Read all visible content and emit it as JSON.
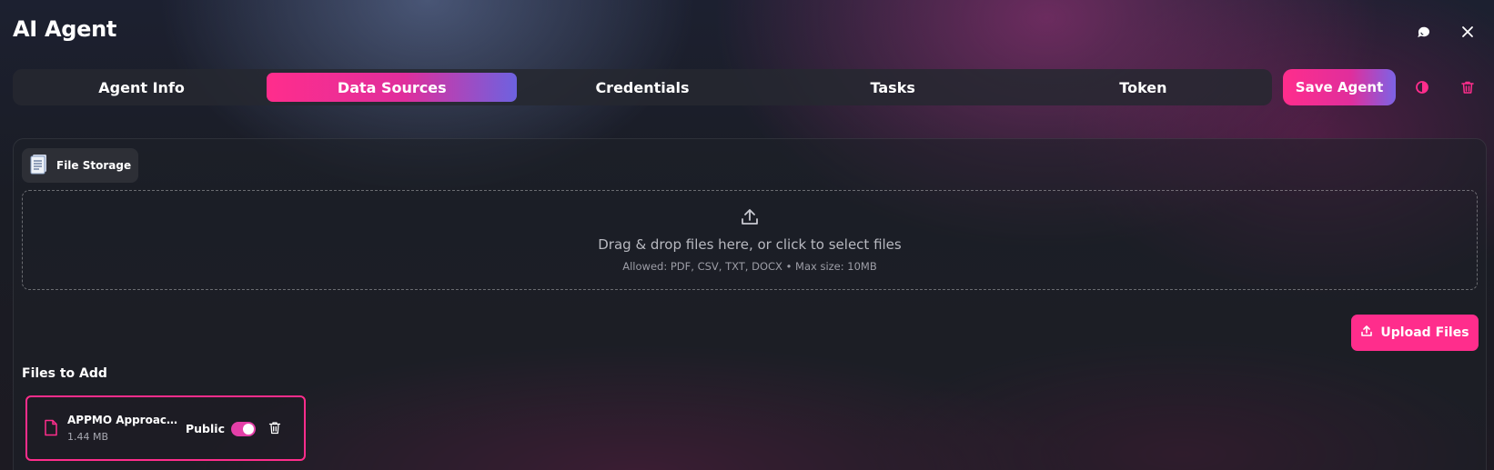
{
  "app": {
    "title": "AI Agent"
  },
  "tabs": [
    {
      "label": "Agent Info",
      "active": false
    },
    {
      "label": "Data Sources",
      "active": true
    },
    {
      "label": "Credentials",
      "active": false
    },
    {
      "label": "Tasks",
      "active": false
    },
    {
      "label": "Token",
      "active": false
    }
  ],
  "actions": {
    "save_label": "Save Agent"
  },
  "icons": {
    "chat": "chat-bubble-icon",
    "close": "close-icon",
    "theme": "half-circle-icon",
    "delete": "trash-icon",
    "storage": "document-stack-icon",
    "upload": "upload-icon",
    "file": "file-icon"
  },
  "colors": {
    "accent": "#ff2d8c",
    "accent_gradient_end": "#6d62e0",
    "toggle_on": "#e43fa8"
  },
  "storage": {
    "chip_label": "File Storage",
    "dropzone": {
      "title": "Drag & drop files here, or click to select files",
      "subtitle": "Allowed: PDF, CSV, TXT, DOCX • Max size: 10MB"
    },
    "upload_label": "Upload Files",
    "files_section_title": "Files to Add",
    "files": [
      {
        "name": "APPMO Approach.docx",
        "size": "1.44 MB",
        "visibility_label": "Public",
        "public": true
      }
    ]
  }
}
